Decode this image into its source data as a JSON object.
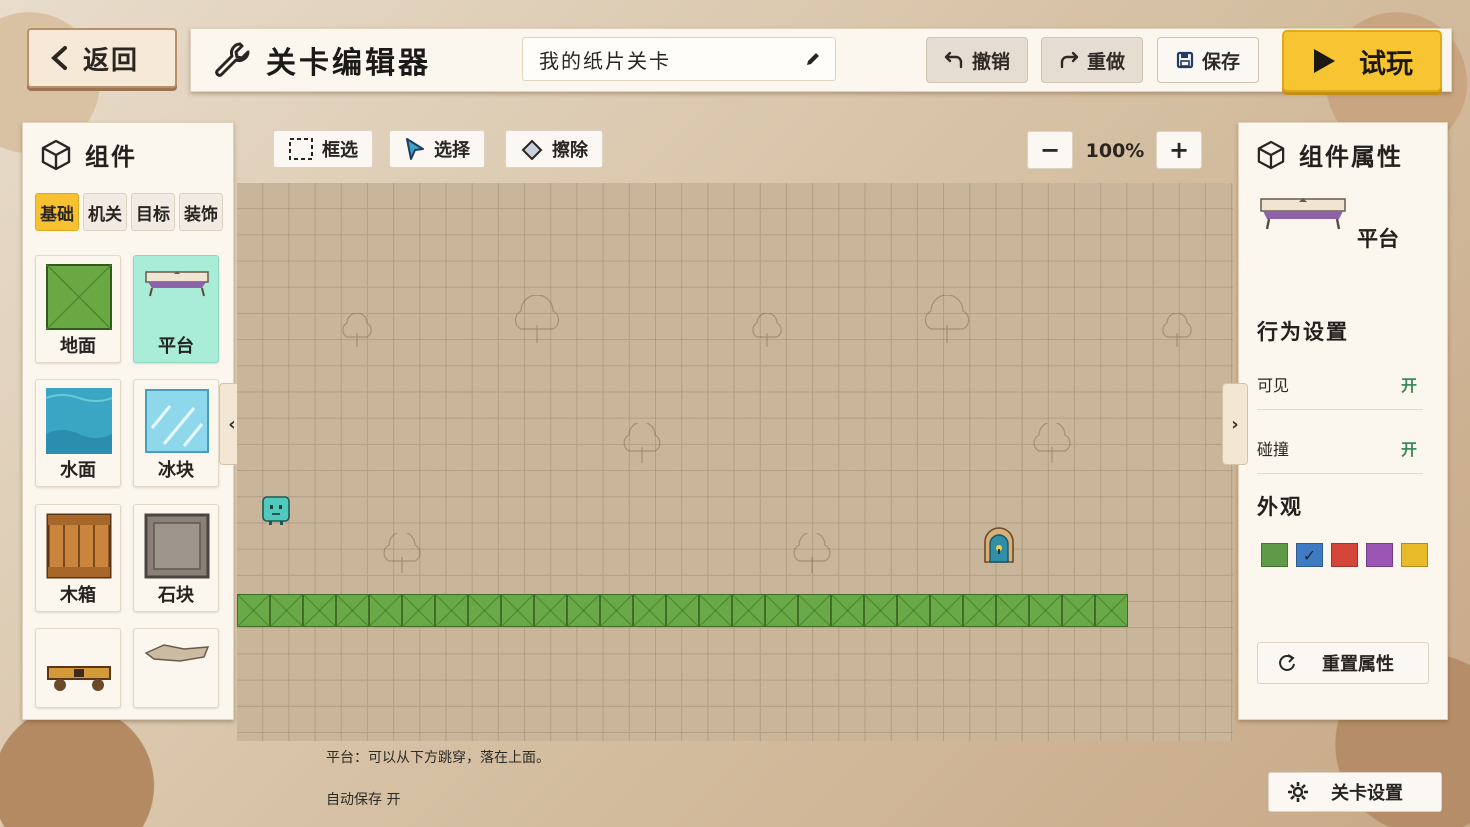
{
  "header": {
    "back_label": "返回",
    "title": "关卡编辑器",
    "level_name": "我的纸片关卡",
    "undo_label": "撤销",
    "redo_label": "重做",
    "save_label": "保存",
    "play_label": "试玩"
  },
  "components_panel": {
    "title": "组件",
    "tabs": [
      "基础",
      "机关",
      "目标",
      "装饰"
    ],
    "active_tab": "基础",
    "items": [
      {
        "label": "地面",
        "icon": "grass-block-icon"
      },
      {
        "label": "平台",
        "icon": "platform-icon",
        "selected": true
      },
      {
        "label": "水面",
        "icon": "water-block-icon"
      },
      {
        "label": "冰块",
        "icon": "ice-block-icon"
      },
      {
        "label": "木箱",
        "icon": "wooden-crate-icon"
      },
      {
        "label": "石块",
        "icon": "stone-block-icon"
      },
      {
        "label": "",
        "icon": "moving-platform-icon"
      },
      {
        "label": "",
        "icon": "crumbling-rock-icon"
      }
    ]
  },
  "canvas_toolbar": {
    "marquee_label": "框选",
    "select_label": "选择",
    "erase_label": "擦除",
    "zoom_out": "−",
    "zoom_level": "100%",
    "zoom_in": "+"
  },
  "properties_panel": {
    "title": "组件属性",
    "selected_name": "平台",
    "behavior_title": "行为设置",
    "visible_label": "可见",
    "visible_value": "开",
    "collision_label": "碰撞",
    "collision_value": "开",
    "appearance_title": "外观",
    "swatches": [
      "#5e9a48",
      "#3e7bc2",
      "#d4463a",
      "#9b55b4",
      "#e9bb2a"
    ],
    "selected_swatch": 1,
    "swatch_mark": "✓",
    "reset_label": "重置属性"
  },
  "footer": {
    "description": "平台：可以从下方跳穿，落在上面。",
    "autosave": "自动保存 开",
    "settings_label": "关卡设置"
  },
  "colors": {
    "accent": "#f6c232",
    "selected_tile": "#a9ecd7",
    "ground_green": "#69a947",
    "player": "#4fc9bd"
  }
}
